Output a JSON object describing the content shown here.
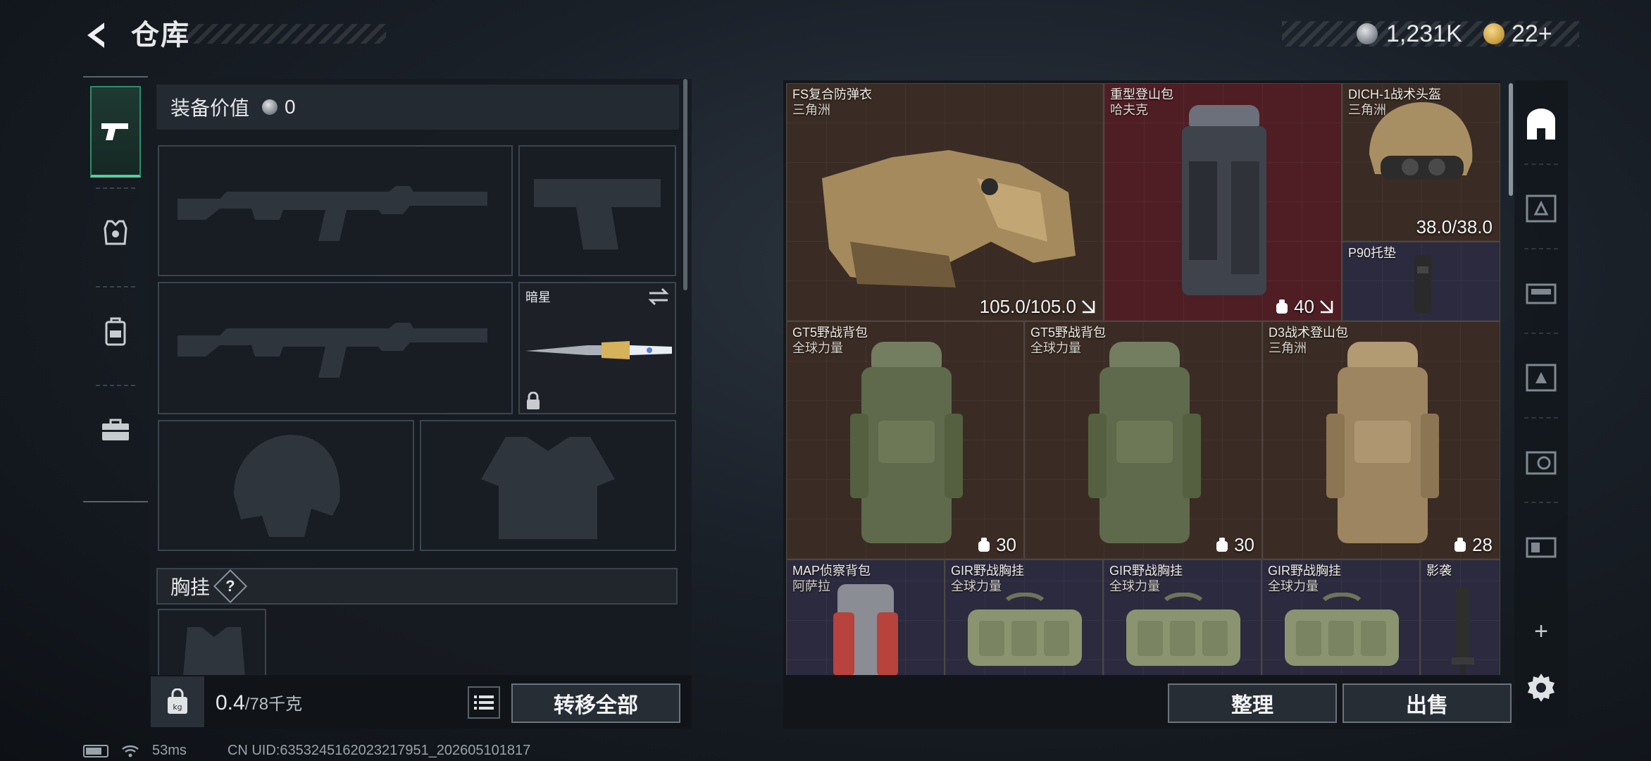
{
  "header": {
    "title": "仓库",
    "currency_a": "1,231K",
    "currency_b": "22+"
  },
  "left_nav": {
    "tabs": [
      {
        "icon": "pistol-icon",
        "active": true
      },
      {
        "icon": "armor-vest-icon",
        "active": false
      },
      {
        "icon": "backpack-icon",
        "active": false
      },
      {
        "icon": "toolbox-icon",
        "active": false
      }
    ]
  },
  "loadout": {
    "equip_value_label": "装备价值",
    "equip_value": "0",
    "melee_name": "暗星",
    "chest_rig_label": "胸挂",
    "chest_help": "?",
    "weight_current": "0.4",
    "weight_max": "/78千克",
    "transfer_all": "转移全部"
  },
  "stash": {
    "items": [
      {
        "name": "FS复合防弹衣",
        "source": "三角洲",
        "stat": "105.0/105.0",
        "color": "#3a2c24"
      },
      {
        "name": "重型登山包",
        "source": "哈夫克",
        "stat": "40",
        "color": "#4e1e24"
      },
      {
        "name": "DICH-1战术头盔",
        "source": "三角洲",
        "stat": "38.0/38.0",
        "color": "#3a2c24"
      },
      {
        "name": "P90托垫",
        "source": "",
        "stat": "",
        "color": "#2c2a3e"
      },
      {
        "name": "GT5野战背包",
        "source": "全球力量",
        "stat": "30",
        "color": "#3a2c24"
      },
      {
        "name": "GT5野战背包",
        "source": "全球力量",
        "stat": "30",
        "color": "#3a2c24"
      },
      {
        "name": "D3战术登山包",
        "source": "三角洲",
        "stat": "28",
        "color": "#3a2c24"
      },
      {
        "name": "MAP侦察背包",
        "source": "阿萨拉",
        "stat": "",
        "color": "#2c2a3e"
      },
      {
        "name": "GIR野战胸挂",
        "source": "全球力量",
        "stat": "",
        "color": "#2c2a3e"
      },
      {
        "name": "GIR野战胸挂",
        "source": "全球力量",
        "stat": "",
        "color": "#2c2a3e"
      },
      {
        "name": "GIR野战胸挂",
        "source": "全球力量",
        "stat": "",
        "color": "#2c2a3e"
      },
      {
        "name": "影袭",
        "source": "",
        "stat": "",
        "color": "#2c2a3e"
      }
    ],
    "sort_label": "整理",
    "sell_label": "出售"
  },
  "right_bar": {
    "tabs": [
      "safe-box-icon",
      "container-a-icon",
      "container-b-icon",
      "container-c-icon",
      "container-d-icon",
      "container-e-icon"
    ],
    "add": "+"
  },
  "status": {
    "ping": "53ms",
    "uid": "CN UID:6353245162023217951_202605101817"
  }
}
